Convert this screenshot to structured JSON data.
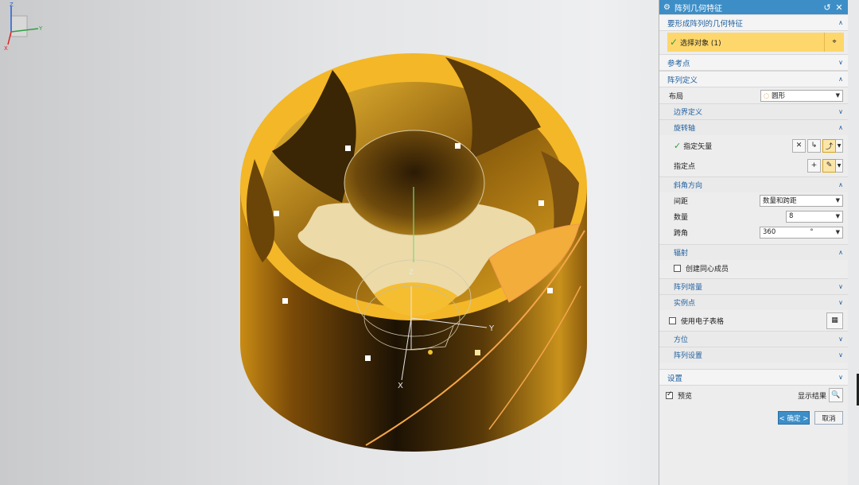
{
  "viewport": {
    "axis_labels": {
      "z": "Z",
      "y": "Y",
      "x": "X"
    },
    "triad_labels": {
      "z": "Z",
      "y": "Y",
      "x": "X"
    },
    "colors": {
      "part_face": "#f4b82c",
      "part_shadow": "#2a1c06",
      "hub_face": "#eddcab",
      "edge_highlight": "#f5a54a"
    }
  },
  "dialog": {
    "title": "阵列几何特征",
    "title_icon": "gear-icon",
    "reset_icon": "reset-icon",
    "close_icon": "close-icon",
    "sections": {
      "features": {
        "label": "要形成阵列的几何特征",
        "select_label": "选择对象 (1)"
      },
      "reference_point": {
        "label": "参考点"
      },
      "pattern_definition": {
        "label": "阵列定义",
        "layout_label": "布局",
        "layout_value": "圆形",
        "boundary_label": "边界定义",
        "rotation_axis": {
          "label": "旋转轴",
          "vector_label": "指定矢量",
          "point_label": "指定点"
        },
        "angular_direction": {
          "label": "斜角方向",
          "spacing_label": "间距",
          "spacing_value": "数量和跨距",
          "count_label": "数量",
          "count_value": "8",
          "span_label": "跨角",
          "span_value": "360",
          "span_unit": "°"
        },
        "radiate": {
          "label": "辐射",
          "concentric_label": "创建同心成员",
          "concentric_checked": false
        },
        "pattern_increment": {
          "label": "阵列增量"
        },
        "instance_point": {
          "label": "实例点"
        },
        "spreadsheet": {
          "label": "使用电子表格",
          "checked": false
        },
        "orientation": {
          "label": "方位"
        },
        "pattern_settings": {
          "label": "阵列设置"
        }
      },
      "settings": {
        "label": "设置"
      }
    },
    "preview": {
      "label": "预览",
      "checked": true,
      "show_result_label": "显示结果"
    },
    "buttons": {
      "ok": "< 确定 >",
      "cancel": "取消"
    },
    "accent_color": "#3d8ec7",
    "highlight_color": "#fdd76b"
  }
}
